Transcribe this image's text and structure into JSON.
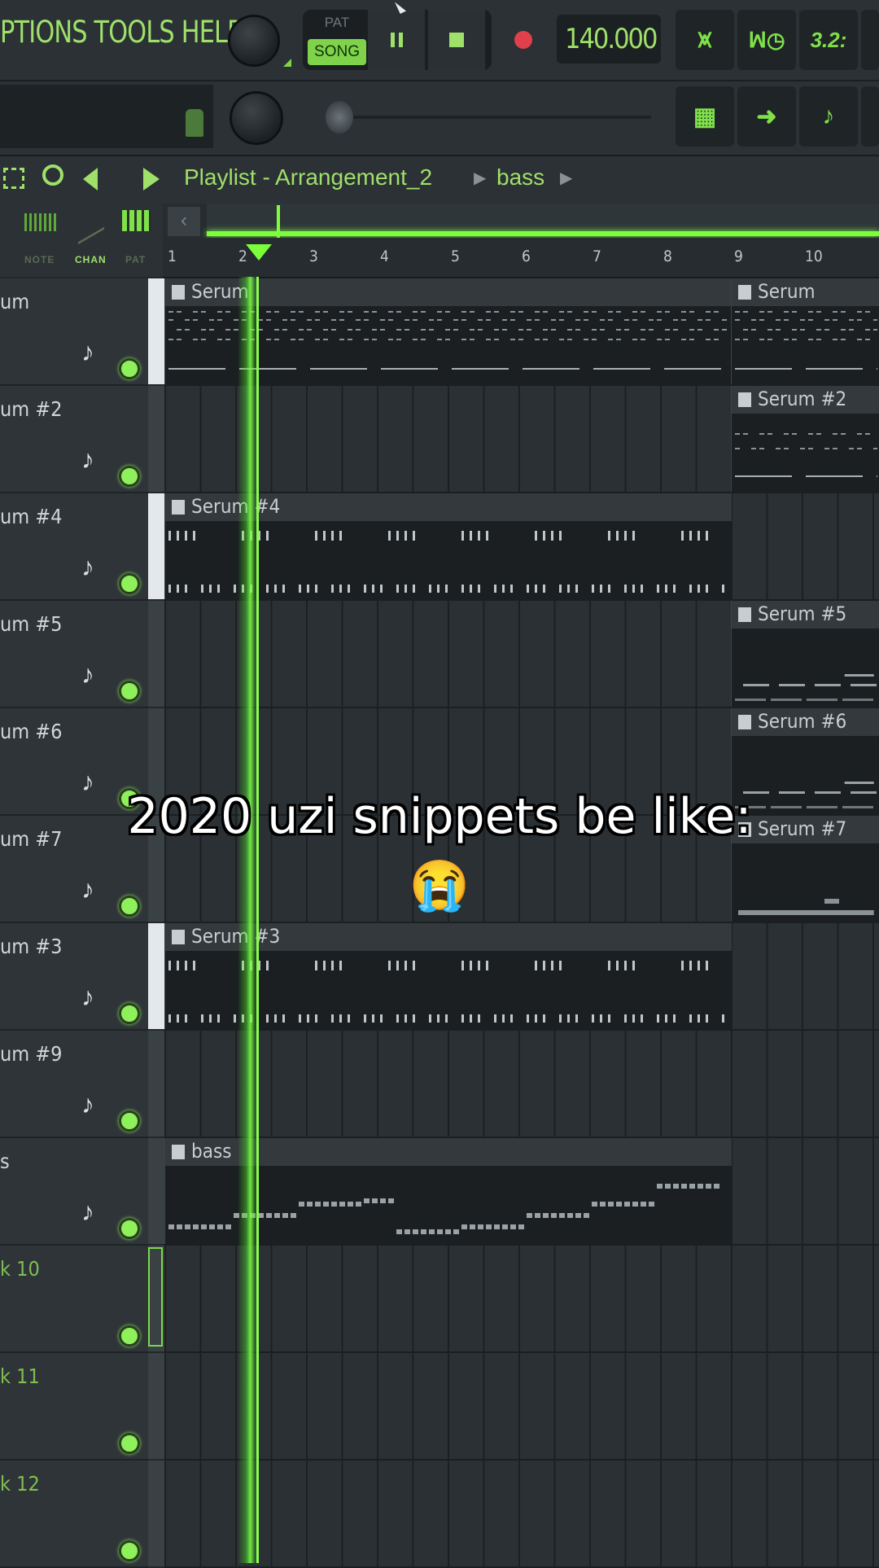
{
  "menu": {
    "text": "PTIONS TOOLS HELP"
  },
  "transport": {
    "pat_label": "PAT",
    "song_label": "SONG",
    "tempo": "140.000"
  },
  "toolbar_buttons": [
    {
      "name": "tuner-icon",
      "glyph": "⩙"
    },
    {
      "name": "time-icon",
      "glyph": "ꟽ◷"
    },
    {
      "name": "counter-icon",
      "glyph": "3.2:"
    }
  ],
  "toolbar2_buttons": [
    {
      "name": "piano-icon",
      "glyph": "▦"
    },
    {
      "name": "arrow-icon",
      "glyph": "➜"
    },
    {
      "name": "plugin-icon",
      "glyph": "♪"
    }
  ],
  "playlist": {
    "title": "Playlist - Arrangement_2",
    "crumb": "bass"
  },
  "tools": {
    "note": "NOTE",
    "chan": "CHAN",
    "pat": "PAT"
  },
  "timeline": {
    "bars": [
      "1",
      "2",
      "3",
      "4",
      "5",
      "6",
      "7",
      "8",
      "9",
      "10"
    ]
  },
  "tracks": [
    {
      "name": "um",
      "clips": [
        {
          "title": "Serum",
          "start": 0,
          "end": 8,
          "pattern": "dash"
        },
        {
          "title": "Serum",
          "start": 8,
          "end": 12,
          "pattern": "dash"
        }
      ],
      "active": true
    },
    {
      "name": "um #2",
      "clips": [
        {
          "title": "Serum #2",
          "start": 8,
          "end": 12,
          "pattern": "dash2"
        }
      ],
      "active": false
    },
    {
      "name": "um #4",
      "clips": [
        {
          "title": "Serum #4",
          "start": 0,
          "end": 8,
          "pattern": "ticks"
        }
      ],
      "active": true
    },
    {
      "name": "um #5",
      "clips": [
        {
          "title": "Serum #5",
          "start": 8,
          "end": 12,
          "pattern": "low"
        }
      ],
      "active": false
    },
    {
      "name": "um #6",
      "clips": [
        {
          "title": "Serum #6",
          "start": 8,
          "end": 12,
          "pattern": "low"
        }
      ],
      "active": false
    },
    {
      "name": "um #7",
      "clips": [
        {
          "title": "Serum #7",
          "start": 8,
          "end": 12,
          "pattern": "bottom"
        }
      ],
      "active": false
    },
    {
      "name": "um #3",
      "clips": [
        {
          "title": "Serum #3",
          "start": 0,
          "end": 8,
          "pattern": "ticks"
        }
      ],
      "active": true
    },
    {
      "name": "um #9",
      "clips": [],
      "active": false
    },
    {
      "name": "s",
      "clips": [
        {
          "title": "bass",
          "start": 0,
          "end": 8,
          "pattern": "bass"
        }
      ],
      "active": false
    },
    {
      "name": "k 10",
      "clips": [],
      "active": false,
      "empty": true
    },
    {
      "name": "k 11",
      "clips": [],
      "active": false,
      "empty": true
    },
    {
      "name": "k 12",
      "clips": [],
      "active": false,
      "empty": true
    }
  ],
  "caption": {
    "line1": "2020 uzi snippets be like:",
    "emoji": "😭"
  },
  "colors": {
    "accent": "#9fe06a",
    "playhead": "#7bff3a",
    "record": "#e0404a"
  }
}
